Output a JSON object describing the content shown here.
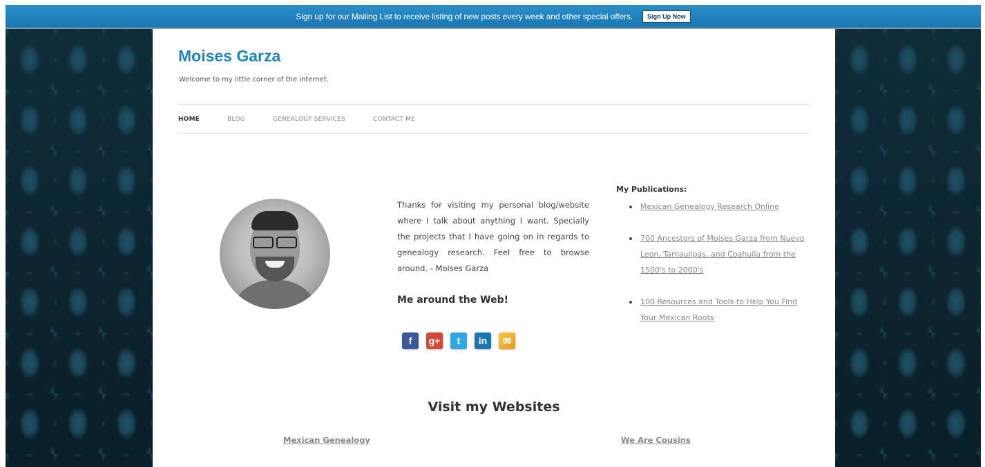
{
  "banner": {
    "text": "Sign up for our Mailing List to receive listing of new posts every week and other special offers.",
    "button": "Sign Up Now"
  },
  "site": {
    "title": "Moises Garza",
    "tagline": "Welcome to my little corner of the internet."
  },
  "nav": {
    "items": [
      {
        "label": "HOME",
        "active": true
      },
      {
        "label": "BLOG"
      },
      {
        "label": "GENEALOGY SERVICES"
      },
      {
        "label": "CONTACT ME"
      }
    ]
  },
  "intro": {
    "text": "Thanks for visiting my personal blog/website where I talk about anything I want. Specially the projects that I have going on in regards to genealogy research. Feel free to browse around. - Moises Garza",
    "web_heading": "Me around the Web!"
  },
  "social": [
    {
      "icon": "facebook-icon",
      "glyph": "f"
    },
    {
      "icon": "google-plus-icon",
      "glyph": "g+"
    },
    {
      "icon": "twitter-icon",
      "glyph": "t"
    },
    {
      "icon": "linkedin-icon",
      "glyph": "in"
    },
    {
      "icon": "mail-icon",
      "glyph": "✉"
    }
  ],
  "publications": {
    "title": "My Publications:",
    "items": [
      "Mexican Genealogy Research Online",
      "700 Ancestors of Moises Garza from Nuevo Leon, Tamaulipas, and Coahuila from the 1500's to 2000's",
      "100 Resources and Tools to Help You Find Your Mexican Roots"
    ]
  },
  "websites": {
    "heading": "Visit my Websites",
    "links": [
      "Mexican Genealogy",
      "We Are Cousins"
    ]
  },
  "colors": {
    "banner": "#1a77b3",
    "title": "#1f84b8",
    "background": "#0d2733"
  }
}
